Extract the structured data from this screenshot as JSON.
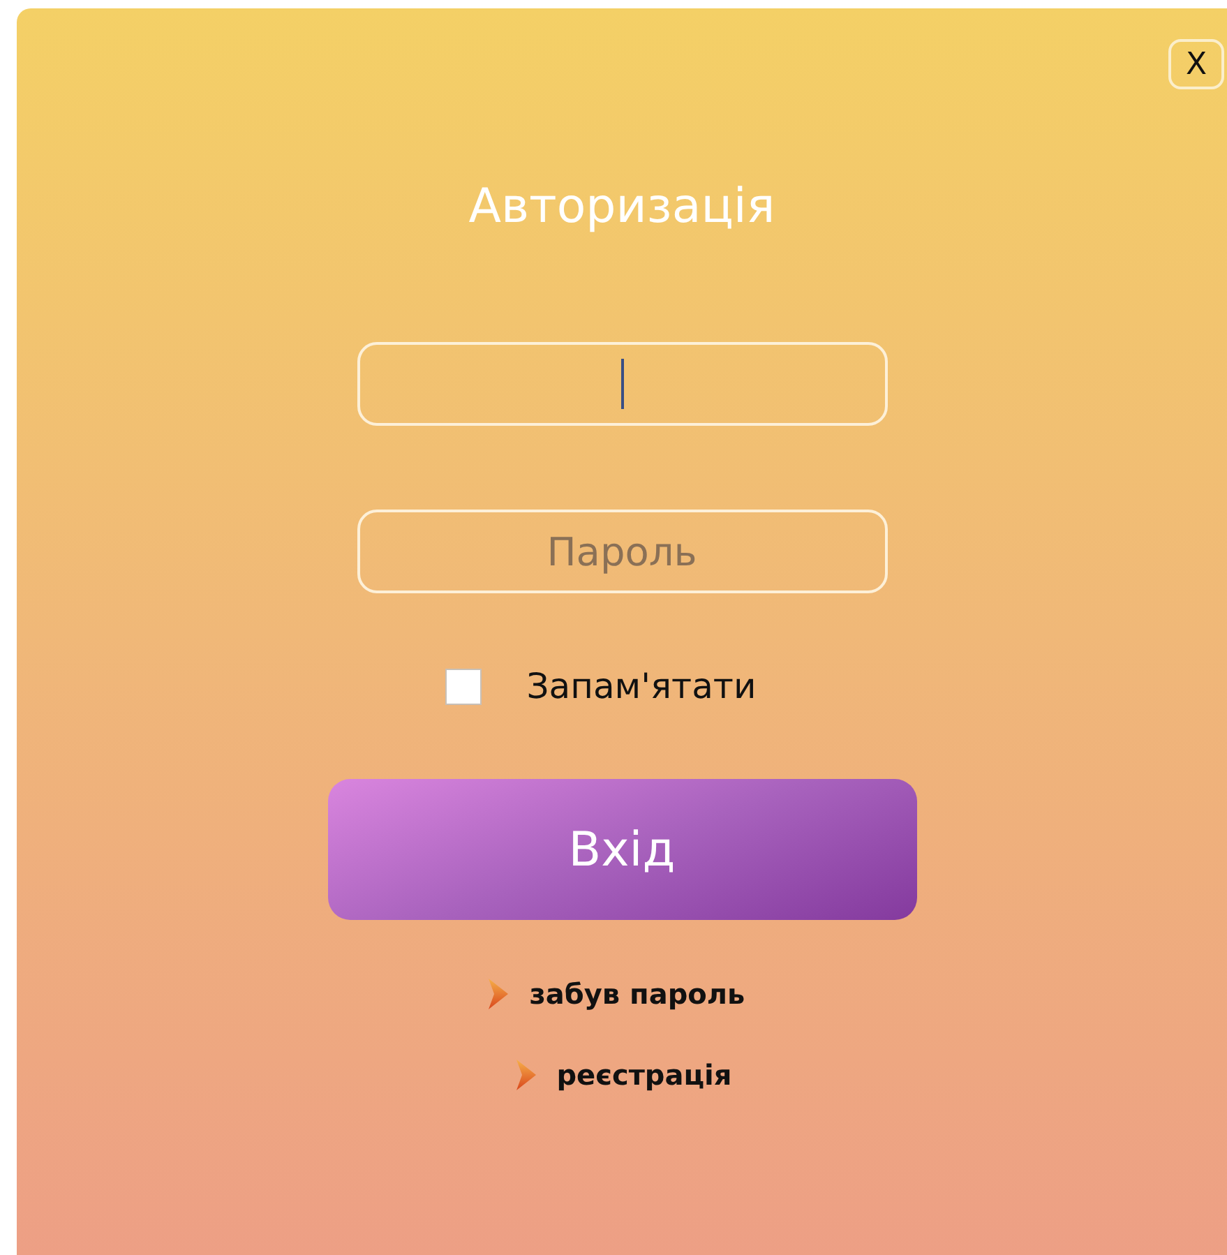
{
  "close_button": {
    "label": "X"
  },
  "title": "Авторизація",
  "fields": [
    {
      "focused": true
    },
    {
      "placeholder": "Пароль",
      "focused": false
    }
  ],
  "remember": {
    "label": "Запам'ятати",
    "checked": false
  },
  "submit_button": {
    "label": "Вхід"
  },
  "links": [
    {
      "label": "забув пароль"
    },
    {
      "label": "реєстрація"
    }
  ]
}
